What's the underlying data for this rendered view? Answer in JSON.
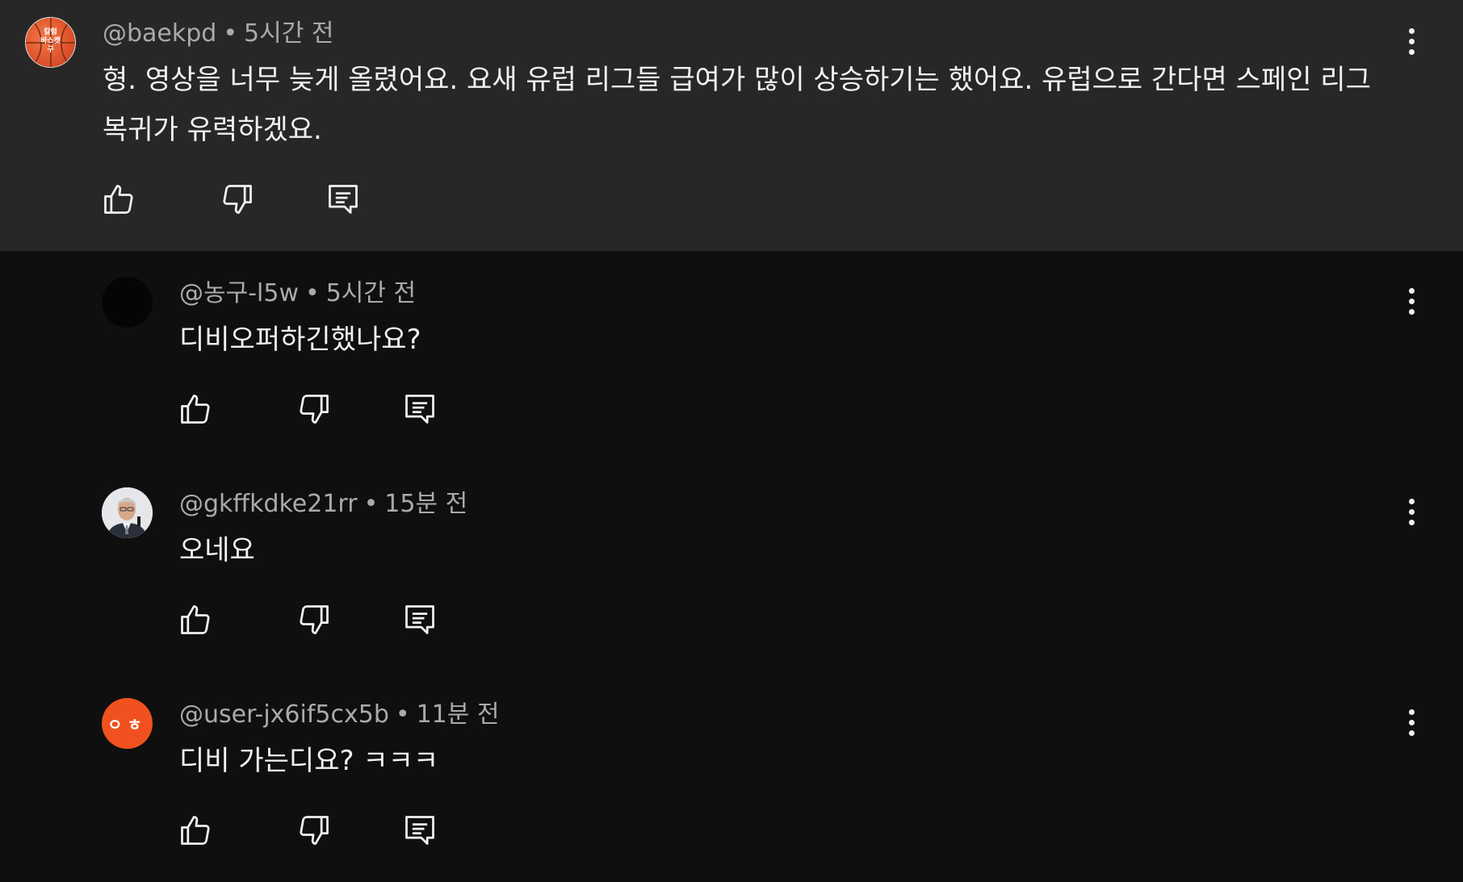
{
  "parent_comment": {
    "handle": "@baekpd",
    "separator": "•",
    "time": "5시간 전",
    "avatar_text": "칼럼\n바스켓\n구",
    "text": "형. 영상을 너무 늦게 올렸어요. 요새 유럽 리그들 급여가 많이 상승하기는 했어요. 유럽으로 간다면 스페인 리그 복귀가 유력하겠요."
  },
  "replies": [
    {
      "handle": "@농구-l5w",
      "separator": "•",
      "time": "5시간 전",
      "text": "디비오퍼하긴했나요?"
    },
    {
      "handle": "@gkffkdke21rr",
      "separator": "•",
      "time": "15분 전",
      "text": "오네요"
    },
    {
      "handle": "@user-jx6if5cx5b",
      "separator": "•",
      "time": "11분 전",
      "text": "디비 가는디요? ㅋㅋㅋ",
      "avatar_text": "ㅇㅎ"
    }
  ],
  "colors": {
    "parent_background": "#272727",
    "page_background": "#0f0f0f",
    "meta_text": "#aaaaaa",
    "body_text": "#f1f1f1",
    "avatar_orange": "#f0511f"
  },
  "icons": [
    "like-icon",
    "dislike-icon",
    "reply-icon",
    "more-vert-icon"
  ]
}
